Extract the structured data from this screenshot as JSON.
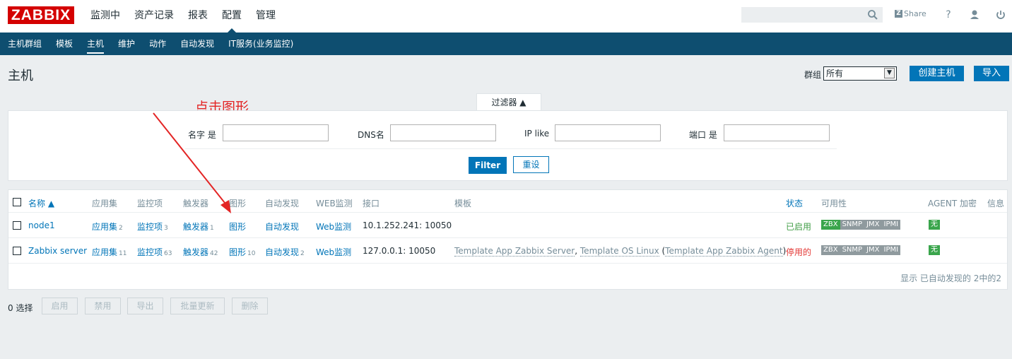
{
  "header": {
    "logo": "ZABBIX",
    "nav": [
      "监测中",
      "资产记录",
      "报表",
      "配置",
      "管理"
    ],
    "active_nav": "配置",
    "share_label": "Share",
    "icons": [
      "search-icon",
      "share-icon",
      "help-icon",
      "user-icon",
      "logout-icon"
    ]
  },
  "subnav": {
    "items": [
      "主机群组",
      "模板",
      "主机",
      "维护",
      "动作",
      "自动发现",
      "IT服务(业务监控)"
    ],
    "active": "主机"
  },
  "page": {
    "title": "主机",
    "group_label": "群组",
    "group_value": "所有",
    "create_button": "创建主机",
    "import_button": "导入"
  },
  "annotation": {
    "text": "点击图形"
  },
  "filter": {
    "tab_label": "过滤器 ▲",
    "fields": [
      {
        "label": "名字 是",
        "value": ""
      },
      {
        "label": "DNS名",
        "value": ""
      },
      {
        "label": "IP like",
        "value": ""
      },
      {
        "label": "端口 是",
        "value": ""
      }
    ],
    "filter_button": "Filter",
    "reset_button": "重设"
  },
  "table": {
    "headers": [
      "名称 ▲",
      "应用集",
      "监控项",
      "触发器",
      "图形",
      "自动发现",
      "WEB监测",
      "接口",
      "模板",
      "状态",
      "可用性",
      "AGENT 加密",
      "信息"
    ],
    "rows": [
      {
        "name": "node1",
        "apps": "应用集",
        "apps_count": "2",
        "items": "监控项",
        "items_count": "3",
        "triggers": "触发器",
        "triggers_count": "1",
        "graphs": "图形",
        "graphs_count": "",
        "discovery": "自动发现",
        "discovery_count": "",
        "web": "Web监测",
        "interface": "10.1.252.241: 10050",
        "template_1": "",
        "template_sep": "",
        "template_2": "",
        "template_open": "",
        "template_3": "",
        "template_close": "",
        "status": "已启用",
        "status_color": "#429e47",
        "availability": [
          "ZBX",
          "SNMP",
          "JMX",
          "IPMI"
        ],
        "availability_colors": [
          "#3aa54c",
          "#8f9a9e",
          "#8f9a9e",
          "#8f9a9e"
        ],
        "encryption": "无"
      },
      {
        "name": "Zabbix server",
        "apps": "应用集",
        "apps_count": "11",
        "items": "监控项",
        "items_count": "63",
        "triggers": "触发器",
        "triggers_count": "42",
        "graphs": "图形",
        "graphs_count": "10",
        "discovery": "自动发现",
        "discovery_count": "2",
        "web": "Web监测",
        "interface": "127.0.0.1: 10050",
        "template_1": "Template App Zabbix Server",
        "template_sep": ", ",
        "template_2": "Template OS Linux",
        "template_open": " (",
        "template_3": "Template App Zabbix Agent",
        "template_close": ")",
        "status": "停用的",
        "status_color": "#e33734",
        "availability": [
          "ZBX",
          "SNMP",
          "JMX",
          "IPMI"
        ],
        "availability_colors": [
          "#8f9a9e",
          "#8f9a9e",
          "#8f9a9e",
          "#8f9a9e"
        ],
        "encryption": "无"
      }
    ],
    "footer": "显示 已自动发现的 2中的2"
  },
  "mass_actions": {
    "selected": "0 选择",
    "buttons": [
      "启用",
      "禁用",
      "导出",
      "批量更新",
      "删除"
    ]
  }
}
